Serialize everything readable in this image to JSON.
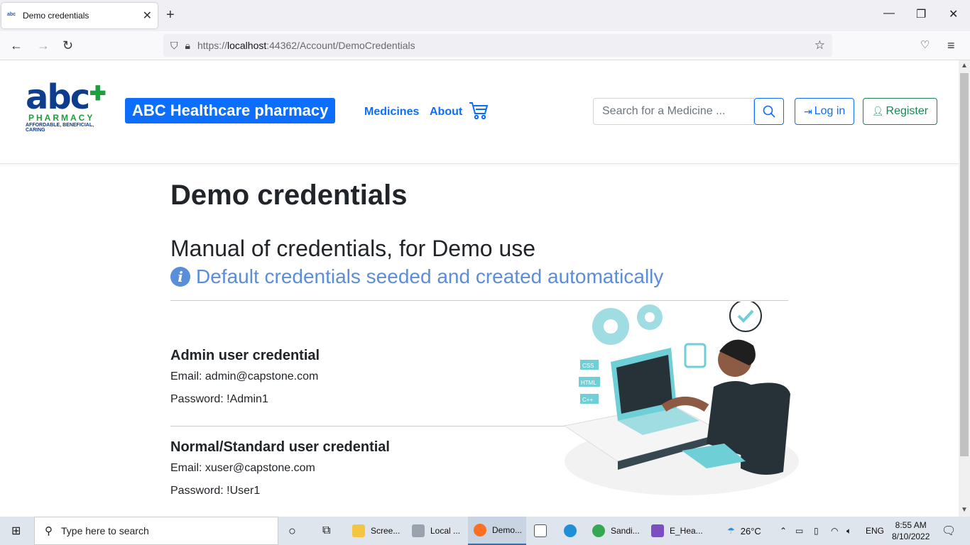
{
  "browser": {
    "tab_title": "Demo credentials",
    "favicon_text": "abc",
    "url_scheme": "https://",
    "url_host": "localhost",
    "url_path": ":44362/Account/DemoCredentials"
  },
  "site": {
    "logo_text": "abc",
    "logo_sub": "PHARMACY",
    "logo_tagline": "AFFORDABLE, BENEFICIAL, CARING",
    "brand": "ABC Healthcare pharmacy",
    "nav": [
      "Medicines",
      "About"
    ],
    "search_placeholder": "Search for a Medicine ...",
    "login_label": "Log in",
    "register_label": "Register"
  },
  "main": {
    "title": "Demo credentials",
    "subtitle": "Manual of credentials, for Demo use",
    "info": "Default credentials seeded and created automatically",
    "admin": {
      "heading": "Admin user credential",
      "email": "Email: admin@capstone.com",
      "password": "Password: !Admin1"
    },
    "normal": {
      "heading": "Normal/Standard user credential",
      "email": "Email: xuser@capstone.com",
      "password": "Password: !User1"
    },
    "illustration_labels": [
      "CSS",
      "HTML",
      "C++"
    ]
  },
  "taskbar": {
    "search_placeholder": "Type here to search",
    "apps": [
      "Scree...",
      "Local ...",
      "Demo...",
      "Sandi...",
      "E_Hea..."
    ],
    "weather": "26°C",
    "lang": "ENG",
    "time": "8:55 AM",
    "date": "8/10/2022"
  },
  "colors": {
    "primary": "#0d6efd",
    "success": "#198754",
    "info": "#5b8ed8",
    "teal": "#6fcfd6"
  }
}
